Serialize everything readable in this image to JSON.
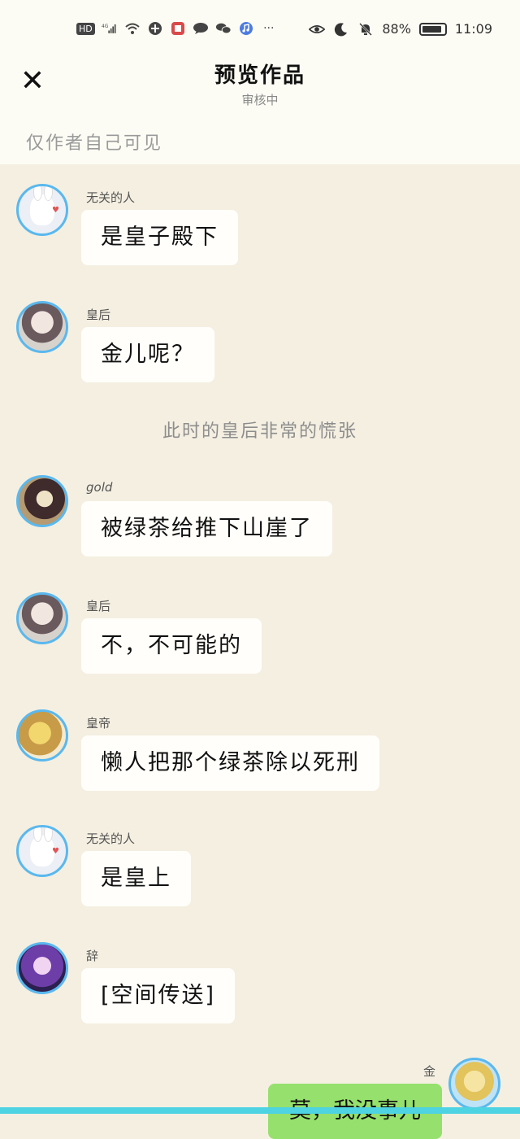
{
  "status_bar": {
    "network_badge": "HD",
    "signal": "4G",
    "battery_percent": "88%",
    "battery_level": 0.88,
    "time": "11:09",
    "more": "···",
    "icons_left": [
      "hd-icon",
      "signal-icon",
      "wifi-icon",
      "browser-icon",
      "red-app-icon",
      "chat-bubble-icon",
      "wechat-icon",
      "music-icon"
    ],
    "icons_right": [
      "eye-icon",
      "moon-icon",
      "mute-bell-icon",
      "battery-icon"
    ]
  },
  "header": {
    "close_icon": "✕",
    "title": "预览作品",
    "subtitle": "审核中",
    "visibility_note": "仅作者自己可见"
  },
  "messages": [
    {
      "sender": "无关的人",
      "text": "是皇子殿下",
      "avatar": "rabbit"
    },
    {
      "sender": "皇后",
      "text": "金儿呢？",
      "avatar": "queen"
    },
    {
      "narration": "此时的皇后非常的慌张"
    },
    {
      "sender": "gold",
      "text": "被绿茶给推下山崖了",
      "avatar": "gold"
    },
    {
      "sender": "皇后",
      "text": "不，不可能的",
      "avatar": "queen"
    },
    {
      "sender": "皇帝",
      "text": "懒人把那个绿茶除以死刑",
      "avatar": "emperor"
    },
    {
      "sender": "无关的人",
      "text": "是皇上",
      "avatar": "rabbit"
    },
    {
      "sender": "辞",
      "text": "[空间传送]",
      "avatar": "ci"
    },
    {
      "sender": "金",
      "text": "莫，我没事儿",
      "avatar": "jin",
      "self": true
    }
  ],
  "colors": {
    "chat_bg": "#f4efe1",
    "header_bg": "#fcfcf4",
    "avatar_ring": "#5ab8ee",
    "self_bubble": "#96e06d",
    "bottom_bar": "#4ed3e2"
  }
}
